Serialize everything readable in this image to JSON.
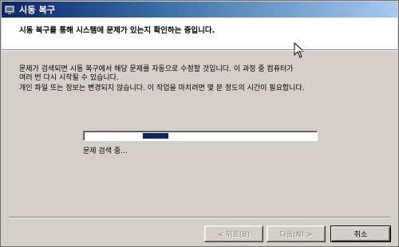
{
  "window": {
    "title": "시동 복구",
    "header_title": "시동 복구를 통해 시스템에 문제가 있는지 확인하는 중입니다."
  },
  "content": {
    "description_line1": "문제가 검색되면 시동 복구에서 해당 문제를 자동으로 수정할 것입니다. 이 과정 중 컴퓨터가",
    "description_line2": "여러 번 다시 시작될 수 있습니다.",
    "privacy_note": "개인 파일 또는 정보는 변경되지 않습니다. 이 작업을 마치려면 몇 분 정도의 시간이 필요합니다.",
    "progress_status": "문제 검색 중...",
    "progress": {
      "mode": "marquee",
      "chunk_start_fraction": 0.25,
      "chunk_length_fraction": 0.11
    }
  },
  "buttons": {
    "back_label": "< 뒤로(B)",
    "next_label": "다음(N) >",
    "cancel_label": "취소"
  },
  "colors": {
    "title_gradient_start": "#0a246a",
    "title_gradient_end": "#a6caf0",
    "progress_chunk": "#0a246a",
    "dialog_face": "#d4d0c8"
  },
  "icons": {
    "title_icon": "startup-repair-icon",
    "cursor": "mouse-pointer-icon"
  }
}
